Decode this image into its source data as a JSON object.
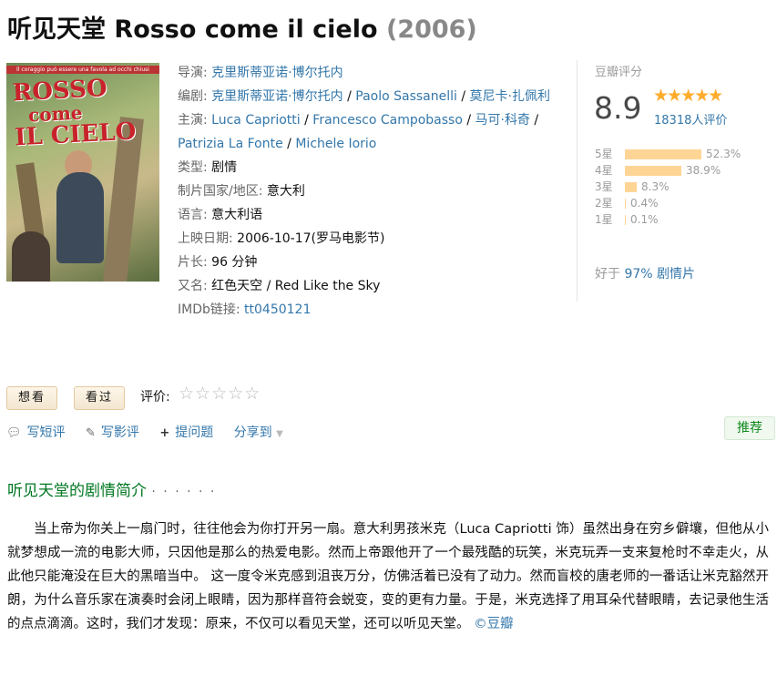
{
  "header": {
    "title": "听见天堂 Rosso come il cielo",
    "year": "(2006)"
  },
  "poster": {
    "tagline": "Il coraggio può essere una favola ad occhi chiusi",
    "title_line1": "ROSSO",
    "title_line2": "come",
    "title_line3": "IL CIELO"
  },
  "info": {
    "director_label": "导演:",
    "director": "克里斯蒂亚诺·博尔托内",
    "writer_label": "编剧:",
    "writers": [
      "克里斯蒂亚诺·博尔托内",
      "Paolo Sassanelli",
      "莫尼卡·扎佩利"
    ],
    "cast_label": "主演:",
    "cast": [
      "Luca Capriotti",
      "Francesco Campobasso",
      "马可·科奇",
      "Patrizia La Fonte",
      "Michele Iorio"
    ],
    "genre_label": "类型:",
    "genre": "剧情",
    "country_label": "制片国家/地区:",
    "country": "意大利",
    "language_label": "语言:",
    "language": "意大利语",
    "release_label": "上映日期:",
    "release": "2006-10-17(罗马电影节)",
    "runtime_label": "片长:",
    "runtime": "96 分钟",
    "aka_label": "又名:",
    "aka": "红色天空 / Red Like the Sky",
    "imdb_label": "IMDb链接:",
    "imdb": "tt0450121"
  },
  "rating": {
    "label": "豆瓣评分",
    "score": "8.9",
    "stars": "★★★★★",
    "votes": "18318人评价",
    "distribution": [
      {
        "label": "5星",
        "pct": "52.3%",
        "value": 52.3
      },
      {
        "label": "4星",
        "pct": "38.9%",
        "value": 38.9
      },
      {
        "label": "3星",
        "pct": "8.3%",
        "value": 8.3
      },
      {
        "label": "2星",
        "pct": "0.4%",
        "value": 0.4
      },
      {
        "label": "1星",
        "pct": "0.1%",
        "value": 0.1
      }
    ],
    "better_prefix": "好于",
    "better_value": "97% 剧情片"
  },
  "actions": {
    "want_label": "想看",
    "seen_label": "看过",
    "rate_label": "评价:",
    "rate_stars": "☆☆☆☆☆",
    "short_review": "写短评",
    "review": "写影评",
    "question": "提问题",
    "share": "分享到",
    "recommend": "推荐"
  },
  "synopsis": {
    "title": "听见天堂的剧情简介",
    "dots": "· · · · · ·",
    "text": "当上帝为你关上一扇门时，往往他会为你打开另一扇。意大利男孩米克（Luca Capriotti 饰）虽然出身在穷乡僻壤，但他从小就梦想成一流的电影大师，只因他是那么的热爱电影。然而上帝跟他开了一个最残酷的玩笑，米克玩弄一支来复枪时不幸走火，从此他只能淹没在巨大的黑暗当中。 这一度令米克感到沮丧万分，仿佛活着已没有了动力。然而盲校的唐老师的一番话让米克豁然开朗，为什么音乐家在演奏时会闭上眼睛，因为那样音符会蜕变，变的更有力量。于是，米克选择了用耳朵代替眼睛，去记录他生活的点点滴滴。这时，我们才发现：原来，不仅可以看见天堂，还可以听见天堂。",
    "source": "©豆瓣"
  },
  "colors": {
    "link": "#3377aa",
    "section_green": "#007722",
    "star": "#ffac2d",
    "bar": "#ffd596"
  }
}
